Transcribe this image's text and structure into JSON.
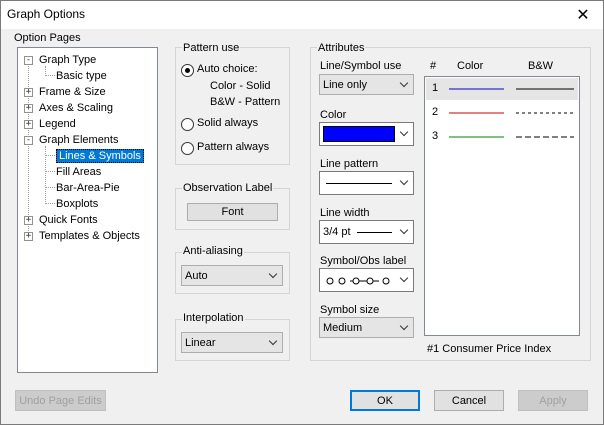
{
  "window": {
    "title": "Graph Options"
  },
  "option_pages": {
    "label": "Option Pages",
    "items": [
      {
        "label": "Graph Type",
        "expander": "-"
      },
      {
        "label": "Basic type",
        "expander": ""
      },
      {
        "label": "Frame & Size",
        "expander": "+"
      },
      {
        "label": "Axes & Scaling",
        "expander": "+"
      },
      {
        "label": "Legend",
        "expander": "+"
      },
      {
        "label": "Graph Elements",
        "expander": "-"
      },
      {
        "label": "Lines & Symbols",
        "expander": "",
        "selected": true
      },
      {
        "label": "Fill Areas",
        "expander": ""
      },
      {
        "label": "Bar-Area-Pie",
        "expander": ""
      },
      {
        "label": "Boxplots",
        "expander": ""
      },
      {
        "label": "Quick Fonts",
        "expander": "+"
      },
      {
        "label": "Templates & Objects",
        "expander": "+"
      }
    ]
  },
  "pattern_use": {
    "label": "Pattern use",
    "auto_choice": "Auto choice:",
    "auto_line1": "Color - Solid",
    "auto_line2": "B&W - Pattern",
    "solid_always": "Solid always",
    "pattern_always": "Pattern always",
    "selected": "auto"
  },
  "observation_label": {
    "label": "Observation Label",
    "font_button": "Font"
  },
  "anti_aliasing": {
    "label": "Anti-aliasing",
    "value": "Auto"
  },
  "interpolation": {
    "label": "Interpolation",
    "value": "Linear"
  },
  "attributes": {
    "label": "Attributes",
    "line_symbol_use": {
      "label": "Line/Symbol use",
      "value": "Line only"
    },
    "color": {
      "label": "Color",
      "value": "#0000ff"
    },
    "line_pattern": {
      "label": "Line pattern"
    },
    "line_width": {
      "label": "Line width",
      "value": "3/4 pt"
    },
    "symbol_obs_label": {
      "label": "Symbol/Obs label"
    },
    "symbol_size": {
      "label": "Symbol size",
      "value": "Medium"
    }
  },
  "series_list": {
    "headers": {
      "num": "#",
      "color": "Color",
      "bw": "B&W"
    },
    "rows": [
      {
        "num": "1",
        "color": "#0000cc",
        "selected": true
      },
      {
        "num": "2",
        "color": "#cc0000",
        "selected": false
      },
      {
        "num": "3",
        "color": "#008000",
        "selected": false
      }
    ],
    "caption": "#1  Consumer Price Index"
  },
  "buttons": {
    "undo": "Undo Page Edits",
    "ok": "OK",
    "cancel": "Cancel",
    "apply": "Apply"
  }
}
